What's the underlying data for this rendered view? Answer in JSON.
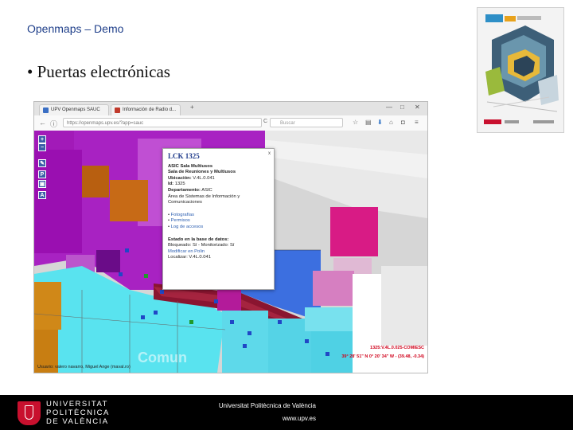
{
  "slide": {
    "title": "Openmaps – Demo",
    "bullet": "• Puertas electrónicas"
  },
  "browser": {
    "tabs": [
      "UPV Openmaps SAUC",
      "Información de Radio d..."
    ],
    "new_tab": "+",
    "window_controls": [
      "—",
      "□",
      "✕"
    ],
    "url": "https://openmaps.upv.es/?app=sauc",
    "search_placeholder": "Buscar",
    "toolbar_icons": [
      "star-icon",
      "bookmark-icon",
      "download-icon",
      "home-icon",
      "shield-icon",
      "menu-icon"
    ]
  },
  "map": {
    "controls": [
      "+",
      "−",
      "✎",
      "P",
      "▣",
      "A"
    ],
    "popup": {
      "title": "LCK 1325",
      "close": "x",
      "line1": "ASIC Sala Multiusos",
      "line2": "Sala de Reuniones y Multiusos",
      "ubicacion_label": "Ubicación:",
      "ubicacion_value": "V.4L.0.041",
      "id_label": "Id:",
      "id_value": "1325",
      "dept_label": "Departamento:",
      "dept_value": "ASIC",
      "dept_extra": "Área de Sistemas de Información y Comunicaciones",
      "links": [
        "Fotografías",
        "Permisos",
        "Log de accesos"
      ],
      "estado_label": "Estado en la base de datos:",
      "bloqueado": "Bloqueado: Sí - Monitorizado: Sí",
      "modificar": "Modificar en Polin",
      "localizar": "Localizar: V.4L.0.041"
    },
    "status_code": "1325:V.4L.0.025-COMIESC",
    "status_coords": "39° 28' 51\" N 0° 20' 34\" W - (39.48, -0.34)",
    "status_user": "Usuario: valero navarro, Miguel Ange (maval.ro)",
    "watermark": "Comun"
  },
  "footer": {
    "logo_line1": "UNIVERSITAT",
    "logo_line2": "POLITÈCNICA",
    "logo_line3": "DE VALÈNCIA",
    "institution": "Universitat Politècnica de València",
    "web": "www.upv.es"
  }
}
